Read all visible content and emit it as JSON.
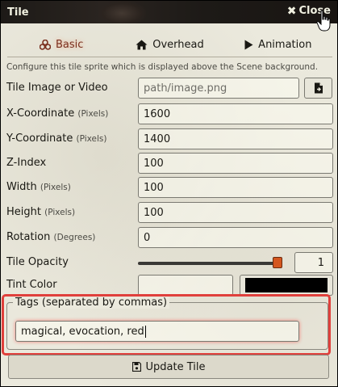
{
  "window": {
    "title": "Tile",
    "close_label": "Close"
  },
  "tabs": [
    {
      "label": "Basic",
      "icon": "cubes-icon",
      "active": true
    },
    {
      "label": "Overhead",
      "icon": "home-icon",
      "active": false
    },
    {
      "label": "Animation",
      "icon": "play-icon",
      "active": false
    }
  ],
  "hint": "Configure this tile sprite which is displayed above the Scene background.",
  "fields": {
    "image": {
      "label": "Tile Image or Video",
      "placeholder": "path/image.png"
    },
    "x": {
      "label": "X-Coordinate",
      "unit": "(Pixels)",
      "value": "1600"
    },
    "y": {
      "label": "Y-Coordinate",
      "unit": "(Pixels)",
      "value": "1400"
    },
    "z": {
      "label": "Z-Index",
      "value": "100"
    },
    "width": {
      "label": "Width",
      "unit": "(Pixels)",
      "value": "100"
    },
    "height": {
      "label": "Height",
      "unit": "(Pixels)",
      "value": "100"
    },
    "rotation": {
      "label": "Rotation",
      "unit": "(Degrees)",
      "value": "0"
    },
    "opacity": {
      "label": "Tile Opacity",
      "value": "1",
      "fraction": 1.0
    },
    "tint": {
      "label": "Tint Color",
      "value": "",
      "swatch_color": "#000000"
    }
  },
  "tags": {
    "legend": "Tags (separated by commas)",
    "value": "magical, evocation, red"
  },
  "submit": {
    "label": "Update Tile",
    "icon": "save-icon"
  },
  "colors": {
    "accent": "#d4561f",
    "highlight": "#e0403c"
  }
}
